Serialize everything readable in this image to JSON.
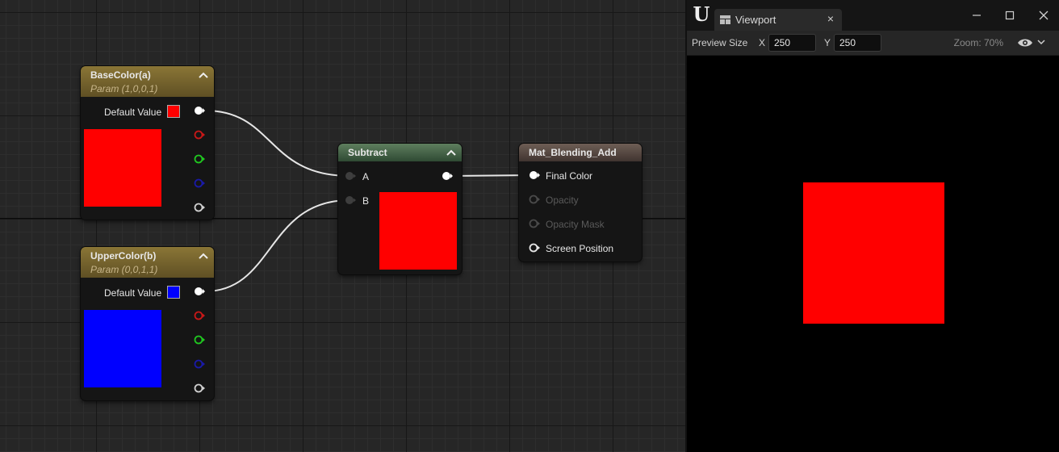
{
  "graph": {
    "nodes": {
      "base_color": {
        "title": "BaseColor(a)",
        "subtitle": "Param (1,0,0,1)",
        "default_value_label": "Default Value",
        "color": "#ff0000"
      },
      "upper_color": {
        "title": "UpperColor(b)",
        "subtitle": "Param (0,0,1,1)",
        "default_value_label": "Default Value",
        "color": "#0000ff"
      },
      "subtract": {
        "title": "Subtract",
        "input_a": "A",
        "input_b": "B",
        "preview_color": "#ff0000"
      },
      "material": {
        "title": "Mat_Blending_Add",
        "pins": [
          "Final Color",
          "Opacity",
          "Opacity Mask",
          "Screen Position"
        ]
      }
    }
  },
  "viewport": {
    "tab_label": "Viewport",
    "tab_close": "×",
    "preview_size_label": "Preview Size",
    "x_label": "X",
    "x_value": "250",
    "y_label": "Y",
    "y_value": "250",
    "zoom_label": "Zoom: 70%",
    "render_color": "#ff0000"
  }
}
